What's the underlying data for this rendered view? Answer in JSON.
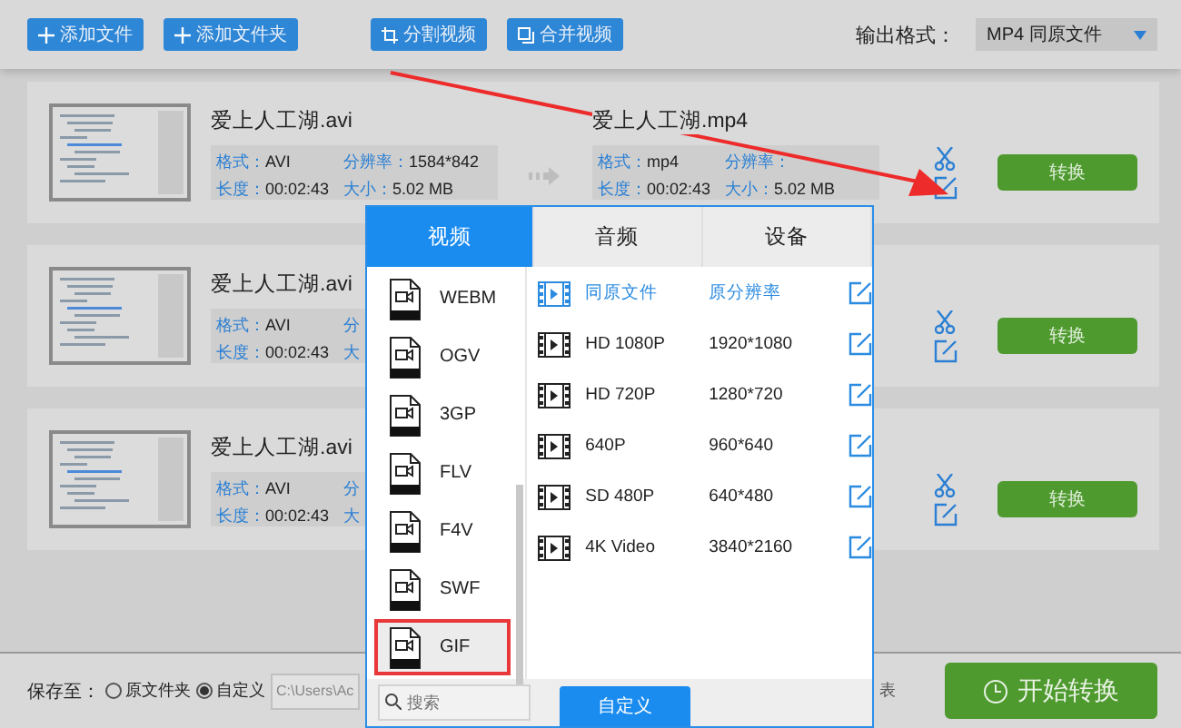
{
  "toolbar": {
    "buttons": [
      {
        "label": "添加文件",
        "kind": "add"
      },
      {
        "label": "添加文件夹",
        "kind": "add"
      },
      {
        "label": "分割视频",
        "kind": "split"
      },
      {
        "label": "合并视频",
        "kind": "merge"
      }
    ],
    "output_label": "输出格式：",
    "output_value": "MP4  同原文件"
  },
  "files": [
    {
      "name": "爱上人工湖.avi",
      "info": [
        {
          "label": "格式：",
          "value": "AVI"
        },
        {
          "label": "分辨率：",
          "value": "1584*842"
        },
        {
          "label": "长度：",
          "value": "00:02:43"
        },
        {
          "label": "大小：",
          "value": "5.02 MB"
        }
      ],
      "output": {
        "name": "爱上人工湖.mp4",
        "info": [
          {
            "label": "格式：",
            "value": "mp4"
          },
          {
            "label": "分辨率："
          },
          {
            "label": "长度：",
            "value": "00:02:43"
          },
          {
            "label": "大小：",
            "value": "5.02 MB"
          }
        ]
      },
      "convert": "转换"
    },
    {
      "name": "爱上人工湖.avi",
      "info": [
        {
          "label": "格式：",
          "value": "AVI"
        },
        {
          "label": "分"
        },
        {
          "label": "长度：",
          "value": "00:02:43"
        },
        {
          "label": "大"
        }
      ],
      "convert": "转换"
    },
    {
      "name": "爱上人工湖.avi",
      "info": [
        {
          "label": "格式：",
          "value": "AVI"
        },
        {
          "label": "分"
        },
        {
          "label": "长度：",
          "value": "00:02:43"
        },
        {
          "label": "大"
        }
      ],
      "convert": "转换"
    }
  ],
  "popup": {
    "tabs": [
      {
        "label": "视频",
        "selected": true
      },
      {
        "label": "音频",
        "selected": false
      },
      {
        "label": "设备",
        "selected": false
      }
    ],
    "formats": [
      {
        "label": "WEBM",
        "selected": false
      },
      {
        "label": "OGV",
        "selected": false
      },
      {
        "label": "3GP",
        "selected": false
      },
      {
        "label": "FLV",
        "selected": false
      },
      {
        "label": "F4V",
        "selected": false
      },
      {
        "label": "SWF",
        "selected": false
      },
      {
        "label": "GIF",
        "selected": true
      }
    ],
    "presets": [
      {
        "name": "同原文件",
        "resolution": "原分辨率",
        "selected": true
      },
      {
        "name": "HD 1080P",
        "resolution": "1920*1080",
        "selected": false
      },
      {
        "name": "HD 720P",
        "resolution": "1280*720",
        "selected": false
      },
      {
        "name": "640P",
        "resolution": "960*640",
        "selected": false
      },
      {
        "name": "SD 480P",
        "resolution": "640*480",
        "selected": false
      },
      {
        "name": "4K Video",
        "resolution": "3840*2160",
        "selected": false
      }
    ],
    "search": {
      "placeholder": "搜索"
    },
    "custom_button": "自定义"
  },
  "footer": {
    "save_label": "保存至：",
    "options": [
      {
        "label": "原文件夹",
        "selected": false
      },
      {
        "label": "自定义",
        "selected": true
      }
    ],
    "path": "C:\\Users\\Ac",
    "hidden_text": "表",
    "start_button": "开始转换"
  }
}
